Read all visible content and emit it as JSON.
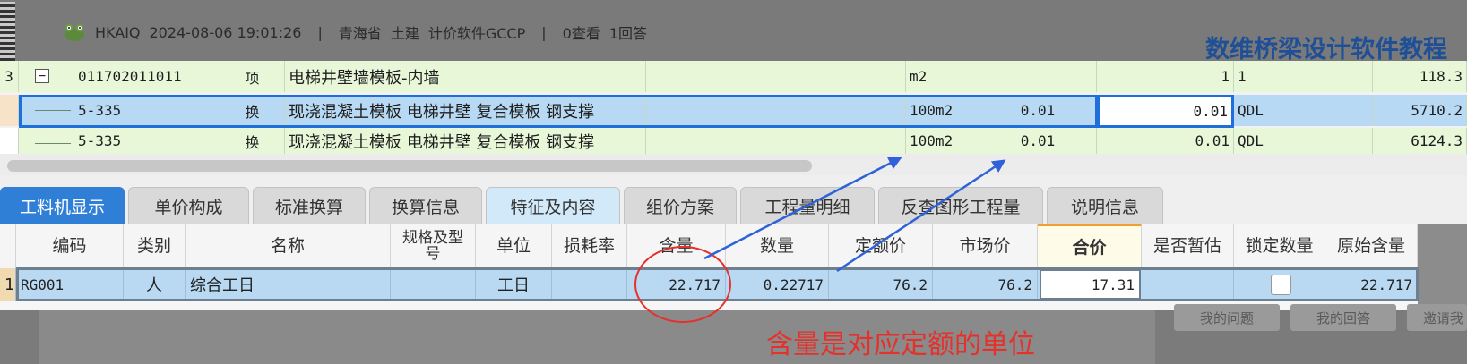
{
  "post": {
    "username": "HKAIQ",
    "datetime": "2024-08-06 19:01:26",
    "separator": "|",
    "region": "青海省",
    "category": "土建",
    "software": "计价软件GCCP",
    "views": "0查看",
    "answers": "1回答",
    "side_title": "数维桥梁设计软件教程"
  },
  "upper_grid": {
    "rows": [
      {
        "index": "3",
        "code": "011702011011",
        "type": "项",
        "name": "电梯井壁墙模板-内墙",
        "unit": "m2",
        "content": "",
        "qty": "1",
        "qty_expr": "1",
        "price": "118.3"
      },
      {
        "index": "",
        "code": "5-335",
        "type": "换",
        "name": "现浇混凝土模板 电梯井壁 复合模板 钢支撑",
        "unit": "100m2",
        "content": "0.01",
        "qty": "0.01",
        "qty_expr": "QDL",
        "price": "5710.2"
      },
      {
        "index": "",
        "code": "5-335",
        "type": "换",
        "name": "现浇混凝土模板 电梯井壁 复合模板 钢支撑",
        "unit": "100m2",
        "content": "0.01",
        "qty": "0.01",
        "qty_expr": "QDL",
        "price": "6124.3"
      }
    ]
  },
  "tabs": [
    {
      "label": "工料机显示",
      "active": true
    },
    {
      "label": "单价构成"
    },
    {
      "label": "标准换算"
    },
    {
      "label": "换算信息"
    },
    {
      "label": "特征及内容"
    },
    {
      "label": "组价方案"
    },
    {
      "label": "工程量明细"
    },
    {
      "label": "反查图形工程量"
    },
    {
      "label": "说明信息"
    }
  ],
  "lower_grid": {
    "headers": [
      "编码",
      "类别",
      "名称",
      "规格及型号",
      "单位",
      "损耗率",
      "含量",
      "数量",
      "定额价",
      "市场价",
      "合价",
      "是否暂估",
      "锁定数量",
      "原始含量"
    ],
    "row": {
      "index": "1",
      "code": "RG001",
      "type": "人",
      "name": "综合工日",
      "spec": "",
      "unit": "工日",
      "loss": "",
      "content": "22.717",
      "qty": "0.22717",
      "quota_price": "76.2",
      "market_price": "76.2",
      "total": "17.31",
      "provisional": "",
      "locked": false,
      "original_content": "22.717"
    }
  },
  "annotation": {
    "text": "含量是对应定额的单位",
    "color": "#e5312b",
    "arrow_color": "#2f62d8"
  },
  "background_buttons": [
    "我的问题",
    "我的回答",
    "邀请我"
  ],
  "colors": {
    "selection_border": "#1e6fd9",
    "active_tab": "#2f7fd6",
    "row_green": "#e7f7d8",
    "row_selected": "#b7d9f3"
  }
}
